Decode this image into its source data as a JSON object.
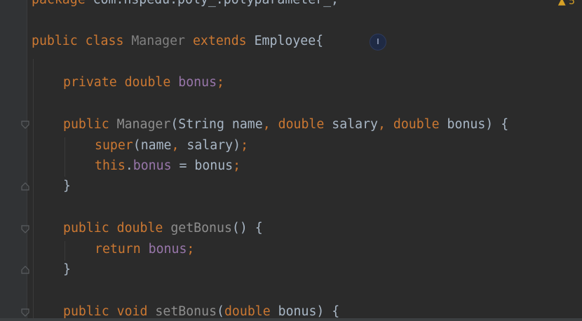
{
  "code": {
    "l0": [
      "package",
      "com.hspedu.poly_.polyparameter_;"
    ],
    "l1": [
      "public",
      "class",
      "Manager",
      "extends",
      "Employee{"
    ],
    "l2": [
      "private",
      "double",
      "bonus",
      ";"
    ],
    "l3": [
      "public",
      "Manager",
      "(String name",
      ",",
      "double",
      "salary",
      ",",
      "double",
      "bonus) {"
    ],
    "l4": [
      "super",
      "(name",
      ",",
      "salary)",
      ";"
    ],
    "l5": [
      "this",
      ".",
      "bonus",
      "= bonus",
      ";"
    ],
    "l6": [
      "}"
    ],
    "l7": [
      "public",
      "double",
      "getBonus",
      "() {"
    ],
    "l8": [
      "return",
      "bonus",
      ";"
    ],
    "l9": [
      "}"
    ],
    "l10": [
      "public",
      "void",
      "setBonus",
      "(",
      "double",
      "bonus) {"
    ]
  },
  "icons": {
    "text_cursor": "I",
    "warning": "▲ 5"
  },
  "colors": {
    "background": "#2b2b2b",
    "keyword": "#cc7832",
    "field": "#9876aa",
    "text": "#a9b7c6",
    "unused": "#808080"
  }
}
